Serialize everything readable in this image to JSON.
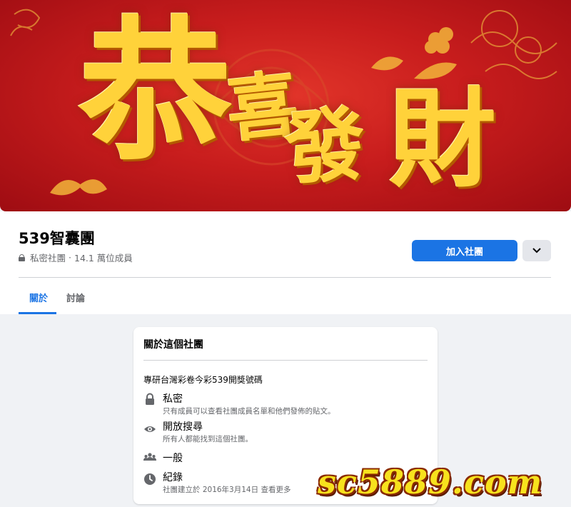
{
  "cover": {
    "chars": [
      "恭",
      "喜",
      "發",
      "財"
    ]
  },
  "group": {
    "name": "539智囊團",
    "privacy": "私密社團",
    "separator": "·",
    "members": "14.1 萬位成員"
  },
  "actions": {
    "join_label": "加入社團",
    "more_icon": "chevron-down-icon"
  },
  "tabs": [
    {
      "label": "關於",
      "active": true
    },
    {
      "label": "討論",
      "active": false
    }
  ],
  "about": {
    "title": "關於這個社團",
    "description": "專研台灣彩卷今彩539開獎號碼",
    "items": [
      {
        "icon": "lock-icon",
        "title": "私密",
        "subtitle": "只有成員可以查看社團成員名單和他們發佈的貼文。"
      },
      {
        "icon": "eye-icon",
        "title": "開放搜尋",
        "subtitle": "所有人都能找到這個社團。"
      },
      {
        "icon": "people-icon",
        "title": "一般",
        "subtitle": ""
      },
      {
        "icon": "clock-icon",
        "title": "紀錄",
        "subtitle": "社團建立於 2016年3月14日 查看更多"
      }
    ]
  },
  "watermark": "sc5889.com",
  "colors": {
    "accent": "#1b74e4",
    "cover_red": "#c81d1d",
    "cover_gold": "#ffd23a",
    "watermark_yellow": "#f7e21d"
  }
}
